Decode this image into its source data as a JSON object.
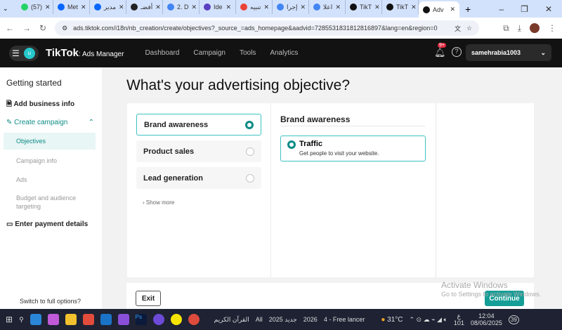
{
  "browser": {
    "tabs": [
      {
        "label": "(57)",
        "color": "#25d366"
      },
      {
        "label": "Met",
        "color": "#0866ff"
      },
      {
        "label": "مدير",
        "color": "#0866ff"
      },
      {
        "label": "أفضـ",
        "color": "#222"
      },
      {
        "label": "2. D",
        "color": "#4285f4"
      },
      {
        "label": "Ide",
        "color": "#5a3fc0"
      },
      {
        "label": "تنبيه",
        "color": "#ea4335"
      },
      {
        "label": "إجرا",
        "color": "#4285f4"
      },
      {
        "label": "اعلا",
        "color": "#4285f4"
      },
      {
        "label": "TikT",
        "color": "#111"
      },
      {
        "label": "TikT",
        "color": "#111"
      },
      {
        "label": "Adv",
        "color": "#111"
      }
    ],
    "url": "ads.tiktok.com/i18n/nb_creation/create/objectives?_source_=ads_homepage&aadvid=7285531831812816897&lang=en&region=0"
  },
  "nav": {
    "avatar": "u",
    "logo": "TikTok",
    "logo_sub": ": Ads Manager",
    "items": [
      "Dashboard",
      "Campaign",
      "Tools",
      "Analytics"
    ],
    "badge": "9+",
    "account": "samehrabia1003"
  },
  "sidebar": {
    "title": "Getting started",
    "add_business": "Add business info",
    "create_campaign": "Create campaign",
    "objectives": "Objectives",
    "campaign_info": "Campaign info",
    "ads": "Ads",
    "budget": "Budget and audience targeting",
    "payment": "Enter payment details",
    "switch": "Switch to full options?"
  },
  "main": {
    "title": "What's your advertising objective?",
    "options": [
      {
        "label": "Brand awareness",
        "selected": true
      },
      {
        "label": "Product sales",
        "selected": false
      },
      {
        "label": "Lead generation",
        "selected": false
      }
    ],
    "show_more": "Show more",
    "detail_title": "Brand awareness",
    "sub_option": {
      "label": "Traffic",
      "desc": "Get people to visit your website."
    }
  },
  "footer": {
    "exit": "Exit",
    "continue": "Continue",
    "watermark1": "Activate Windows",
    "watermark2": "Go to Settings to activate Windows."
  },
  "taskbar": {
    "quran": "القرآن الكريم",
    "all": "All",
    "new2025": "جديد 2025",
    "y2026": "2026",
    "freelancer": "4 - Free lancer",
    "temp": "31°C",
    "lang": "ع",
    "lang2": "101",
    "time": "12:04",
    "date": "08/06/2025",
    "notif": "39"
  }
}
